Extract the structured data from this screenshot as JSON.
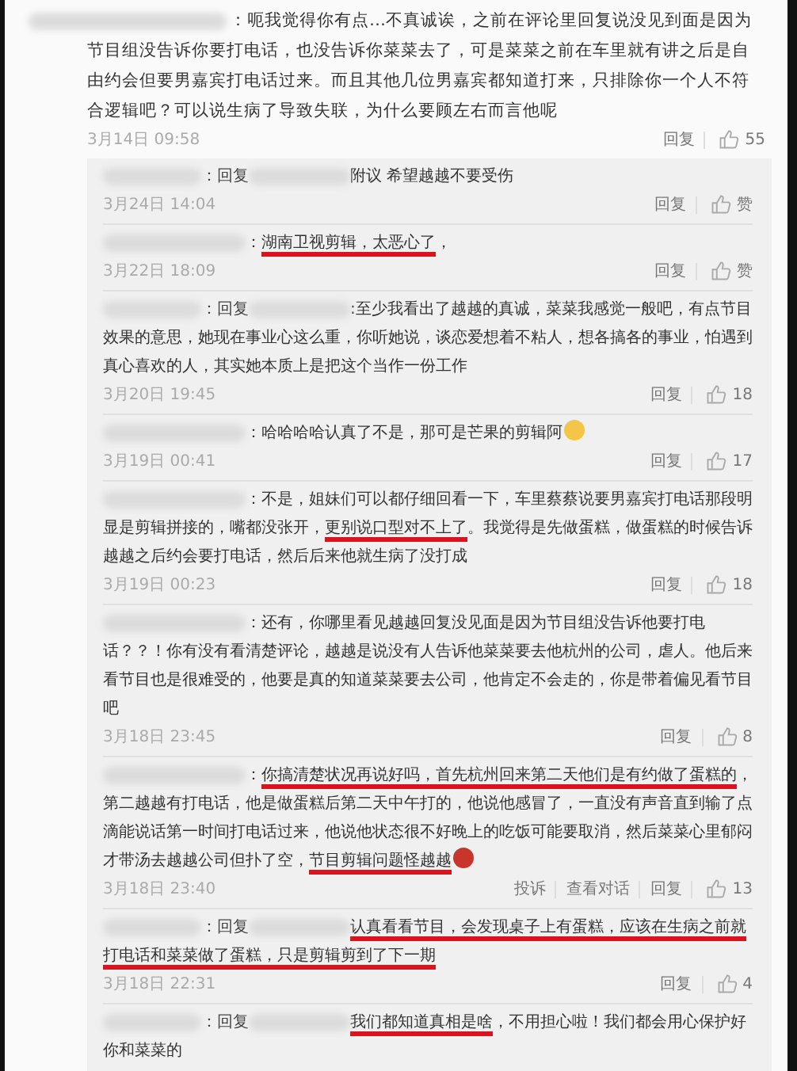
{
  "main_comment": {
    "segments": [
      {
        "text": "：呃我觉得你有点…不真诚诶，之前在评论里回复说没见到面是因为节目组没告诉你要打电话，也没告诉你菜菜去了，可是菜菜之前在车里就有讲之后是自由约会但要男嘉宾打电话过来。而且其他几位男嘉宾都知道打来，只排除你一个人不符合逻辑吧？可以说生病了导致失联，为什么要顾左右而言他呢",
        "underlined": false
      }
    ],
    "date": "3月14日 09:58",
    "actions": [
      "回复"
    ],
    "likes": "55"
  },
  "replies": [
    {
      "kind": "reply",
      "reply_label": "：回复",
      "segments": [
        {
          "text": "附议 希望越越不要受伤",
          "underlined": false
        }
      ],
      "date": "3月24日 14:04",
      "actions": [
        "回复"
      ],
      "likes": "赞"
    },
    {
      "kind": "comment",
      "segments": [
        {
          "text": "：",
          "underlined": false
        },
        {
          "text": "湖南卫视剪辑，太恶心了",
          "underlined": true
        },
        {
          "text": "，",
          "underlined": false
        }
      ],
      "date": "3月22日 18:09",
      "actions": [
        "回复"
      ],
      "likes": "赞"
    },
    {
      "kind": "reply",
      "reply_label": "：回复",
      "segments": [
        {
          "text": ":至少我看出了越越的真诚，菜菜我感觉一般吧，有点节目效果的意思，她现在事业心这么重，你听她说，谈恋爱想着不粘人，想各搞各的事业，怕遇到真心喜欢的人，其实她本质上是把这个当作一份工作",
          "underlined": false
        }
      ],
      "date": "3月20日 19:45",
      "actions": [
        "回复"
      ],
      "likes": "18"
    },
    {
      "kind": "comment",
      "segments": [
        {
          "text": "：哈哈哈哈认真了不是，那可是芒果的剪辑阿",
          "underlined": false
        },
        {
          "kind": "emoji",
          "color": "#f3c64a"
        }
      ],
      "date": "3月19日 00:41",
      "actions": [
        "回复"
      ],
      "likes": "17"
    },
    {
      "kind": "comment",
      "segments": [
        {
          "text": "：不是，姐妹们可以都仔细回看一下，车里蔡蔡说要男嘉宾打电话那段明显是剪辑拼接的，嘴都没张开，",
          "underlined": false
        },
        {
          "text": "更别说口型对不上了",
          "underlined": true
        },
        {
          "text": "。我觉得是先做蛋糕，做蛋糕的时候告诉越越之后约会要打电话，然后后来他就生病了没打成",
          "underlined": false
        }
      ],
      "date": "3月19日 00:23",
      "actions": [
        "回复"
      ],
      "likes": "18"
    },
    {
      "kind": "comment",
      "segments": [
        {
          "text": "：还有，你哪里看见越越回复没见面是因为节目组没告诉他要打电话？？！你有没有看清楚评论，越越是说没有人告诉他菜菜要去他杭州的公司，虐人。他后来看节目也是很难受的，他要是真的知道菜菜要去公司，他肯定不会走的，你是带着偏见看节目吧",
          "underlined": false
        }
      ],
      "date": "3月18日 23:45",
      "actions": [
        "回复"
      ],
      "likes": "8"
    },
    {
      "kind": "comment",
      "segments": [
        {
          "text": "：",
          "underlined": false
        },
        {
          "text": "你搞清楚状况再说好吗，首先杭州回来第二天他们是有约做了蛋糕的",
          "underlined": true
        },
        {
          "text": "，第二越越有打电话，他是做蛋糕后第二天中午打的，他说他感冒了，一直没有声音直到输了点滴能说话第一时间打电话过来，他说他状态很不好晚上的吃饭可能要取消，然后菜菜心里郁闷才带汤去越越公司但扑了空，",
          "underlined": false
        },
        {
          "text": "节目剪辑问题怪越越",
          "underlined": true
        },
        {
          "kind": "emoji",
          "color": "#c8352b"
        }
      ],
      "date": "3月18日 23:40",
      "actions": [
        "投诉",
        "查看对话",
        "回复"
      ],
      "likes": "13"
    },
    {
      "kind": "reply",
      "reply_label": "：回复",
      "segments": [
        {
          "text": "认真看看节目，会发现桌子上有蛋糕，应该在生病之前就打电话和菜菜做了蛋糕，只是剪辑剪到了下一期",
          "underlined": true
        }
      ],
      "date": "3月18日 22:31",
      "actions": [
        "回复"
      ],
      "likes": "4"
    },
    {
      "kind": "reply",
      "reply_label": "：回复",
      "segments": [
        {
          "text": "我们都知道真相是啥",
          "underlined": true
        },
        {
          "text": "，不用担心啦！我们都会用心保护好你和菜菜的",
          "underlined": false
        }
      ]
    }
  ]
}
